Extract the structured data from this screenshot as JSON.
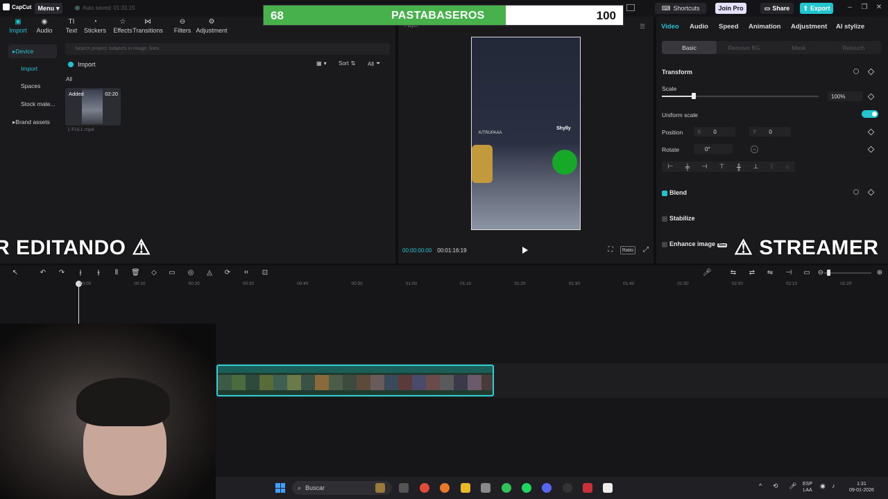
{
  "app": {
    "logo": "CapCut",
    "menu_label": "Menu",
    "autosave": "Auto saved: 01:31:15"
  },
  "header": {
    "shortcuts": "Shortcuts",
    "join_pro": "Join Pro",
    "share": "Share",
    "export": "Export"
  },
  "scoreboard": {
    "left_score": "68",
    "title": "PASTABASEROS",
    "right_score": "100",
    "fill_fraction": 0.68,
    "fill_color": "#47b24c"
  },
  "media_tabs": [
    "Import",
    "Audio",
    "Text",
    "Stickers",
    "Effects",
    "Transitions",
    "Filters",
    "Adjustment"
  ],
  "sidebar": {
    "device": "Device",
    "import": "Import",
    "spaces": "Spaces",
    "stock": "Stock mate...",
    "brand": "Brand assets"
  },
  "media": {
    "search_placeholder": "Search project, subjects in image, lines",
    "import_label": "Import",
    "sort_label": "Sort",
    "all_filter": "All",
    "all_label": "All",
    "clip_added": "Added",
    "clip_duration": "02:20",
    "clip_name": "1-FULL.mp4"
  },
  "player": {
    "label": "Player",
    "current_time": "00:00:00:00",
    "duration": "00:01:16:19",
    "ratio": "Ratio",
    "overlay_text_1": "K/TRUPAAA",
    "overlay_text_2": "Shylly"
  },
  "props": {
    "tabs": [
      "Video",
      "Audio",
      "Speed",
      "Animation",
      "Adjustment",
      "AI stylize"
    ],
    "subtabs": [
      "Basic",
      "Remove BG",
      "Mask",
      "Retouch"
    ],
    "transform": "Transform",
    "scale_label": "Scale",
    "scale_value": "100%",
    "uniform_scale": "Uniform scale",
    "position_label": "Position",
    "pos_x_label": "X",
    "pos_x": "0",
    "pos_y_label": "Y",
    "pos_y": "0",
    "rotate_label": "Rotate",
    "rotate_value": "0°",
    "blend": "Blend",
    "stabilize": "Stabilize",
    "enhance": "Enhance image",
    "new_badge": "New"
  },
  "banners": {
    "left": "R EDITANDO ⚠",
    "right": "⚠ STREAMER"
  },
  "timeline": {
    "ticks": [
      "00:00",
      "00:10",
      "00:20",
      "00:30",
      "00:40",
      "00:50",
      "01:00",
      "01:10",
      "01:20",
      "01:30",
      "01:40",
      "01:50",
      "02:00",
      "02:10",
      "02:20"
    ]
  },
  "taskbar": {
    "search": "Buscar",
    "lang_1": "ESP",
    "lang_2": "LAA",
    "time": "1:31",
    "date": "09-01-2026"
  },
  "colors": {
    "accent": "#22c4d0",
    "score_green": "#47b24c"
  }
}
